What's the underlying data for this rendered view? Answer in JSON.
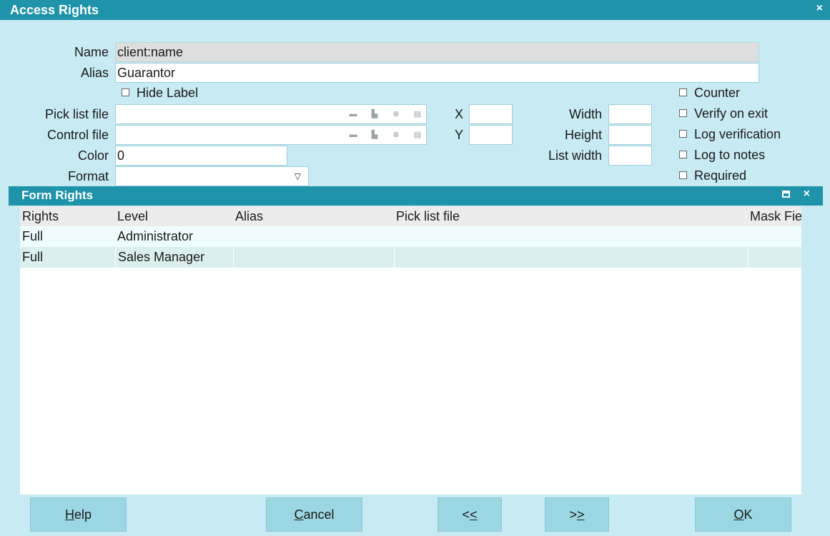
{
  "window": {
    "title": "Access Rights",
    "close": "×"
  },
  "fields": {
    "name_label": "Name",
    "name_value": "client:name",
    "alias_label": "Alias",
    "alias_value": "Guarantor",
    "hide_label": "Hide Label",
    "pick_list_label": "Pick list file",
    "pick_list_value": "",
    "control_file_label": "Control file",
    "control_file_value": "",
    "color_label": "Color",
    "color_value": "0",
    "format_label": "Format",
    "format_value": "",
    "x_label": "X",
    "x_value": "",
    "y_label": "Y",
    "y_value": "",
    "width_label": "Width",
    "width_value": "",
    "height_label": "Height",
    "height_value": "",
    "list_width_label": "List width",
    "list_width_value": ""
  },
  "checkboxes": [
    {
      "label": "Counter",
      "checked": false
    },
    {
      "label": "Verify on exit",
      "checked": false
    },
    {
      "label": "Log verification",
      "checked": false
    },
    {
      "label": "Log to notes",
      "checked": false
    },
    {
      "label": "Required",
      "checked": false
    }
  ],
  "form_rights": {
    "title": "Form Rights",
    "close": "×",
    "columns": [
      "Rights",
      "Level",
      "Alias",
      "Pick list file",
      "Mask Fie"
    ],
    "rows": [
      [
        "Full",
        "Administrator",
        "",
        "",
        ""
      ],
      [
        "Full",
        "Sales Manager",
        "",
        "",
        ""
      ]
    ]
  },
  "buttons": {
    "help": {
      "mnemonic": "H",
      "rest": "elp"
    },
    "cancel": {
      "mnemonic": "C",
      "rest": "ancel"
    },
    "prev": {
      "pre": "<",
      "mnemonic": "<"
    },
    "next": {
      "pre": ">",
      "mnemonic": ">"
    },
    "ok": {
      "mnemonic": "O",
      "rest": "K"
    }
  },
  "icons": {
    "file_field": [
      "folder-open-icon",
      "print-icon",
      "clear-icon",
      "lookup-icon"
    ],
    "dropdown": "chevron-down-icon"
  },
  "colors": {
    "titlebar": "#1f93aa",
    "background": "#c8ebf3",
    "button": "#9ad7e3"
  }
}
